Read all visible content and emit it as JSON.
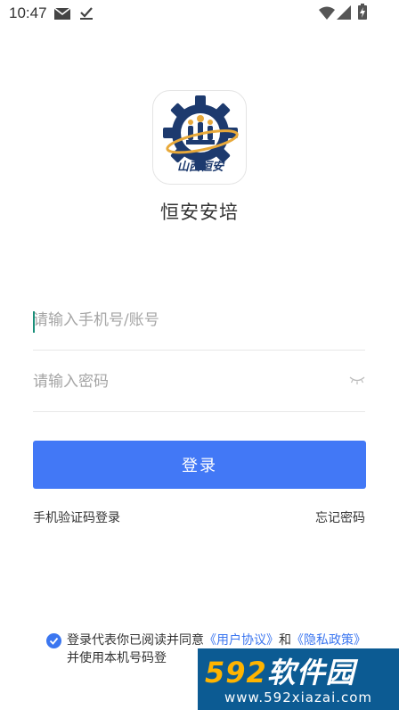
{
  "status_bar": {
    "time": "10:47",
    "left_icons": [
      "mail-icon",
      "download-done-icon"
    ],
    "right_icons": [
      "wifi-icon",
      "signal-icon",
      "battery-charging-icon"
    ]
  },
  "app": {
    "logo_text": "山西恒安",
    "name": "恒安安培"
  },
  "form": {
    "account_placeholder": "请输入手机号/账号",
    "account_value": "",
    "password_placeholder": "请输入密码",
    "password_value": "",
    "password_toggle_icon": "eye-closed-icon",
    "login_label": "登录",
    "sms_login_label": "手机验证码登录",
    "forgot_label": "忘记密码"
  },
  "agreement": {
    "checked": true,
    "prefix": "登录代表你已阅读并同意",
    "user_agreement": "《用户协议》",
    "and": "和",
    "privacy_policy": "《隐私政策》",
    "suffix": "并使用本机号码登"
  },
  "watermark": {
    "number": "592",
    "title": "软件园",
    "url": "www.592xiazai.com"
  },
  "colors": {
    "primary": "#4278f6",
    "link": "#3b76f0",
    "caret": "#1a8f7a",
    "logo_navy": "#1d3a6e",
    "logo_gold": "#e8a93a",
    "watermark_bg": "#0c5b93",
    "watermark_num": "#ffb400"
  }
}
